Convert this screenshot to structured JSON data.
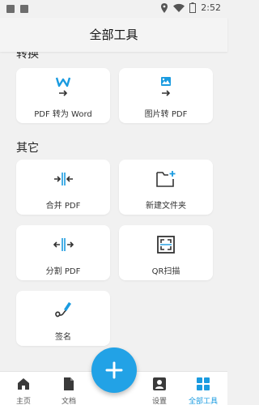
{
  "status_bar": {
    "time": "2:52"
  },
  "app_bar": {
    "title": "全部工具"
  },
  "sections": {
    "convert": {
      "title": "转换"
    },
    "other": {
      "title": "其它"
    }
  },
  "tiles": {
    "pdf_to_word": {
      "label": "PDF 转为 Word",
      "icon": "word-convert-icon"
    },
    "image_to_pdf": {
      "label": "图片转 PDF",
      "icon": "image-convert-icon"
    },
    "merge_pdf": {
      "label": "合并 PDF",
      "icon": "merge-icon"
    },
    "new_folder": {
      "label": "新建文件夹",
      "icon": "new-folder-icon"
    },
    "split_pdf": {
      "label": "分割 PDF",
      "icon": "split-icon"
    },
    "qr_scan": {
      "label": "QR扫描",
      "icon": "qr-scan-icon"
    },
    "signature": {
      "label": "签名",
      "icon": "signature-icon"
    }
  },
  "bottom_nav": {
    "home": "主页",
    "documents": "文档",
    "settings": "设置",
    "all_tools": "全部工具"
  },
  "colors": {
    "accent": "#1a9be0",
    "fab": "#22a2e6",
    "icon_dark": "#333333"
  }
}
